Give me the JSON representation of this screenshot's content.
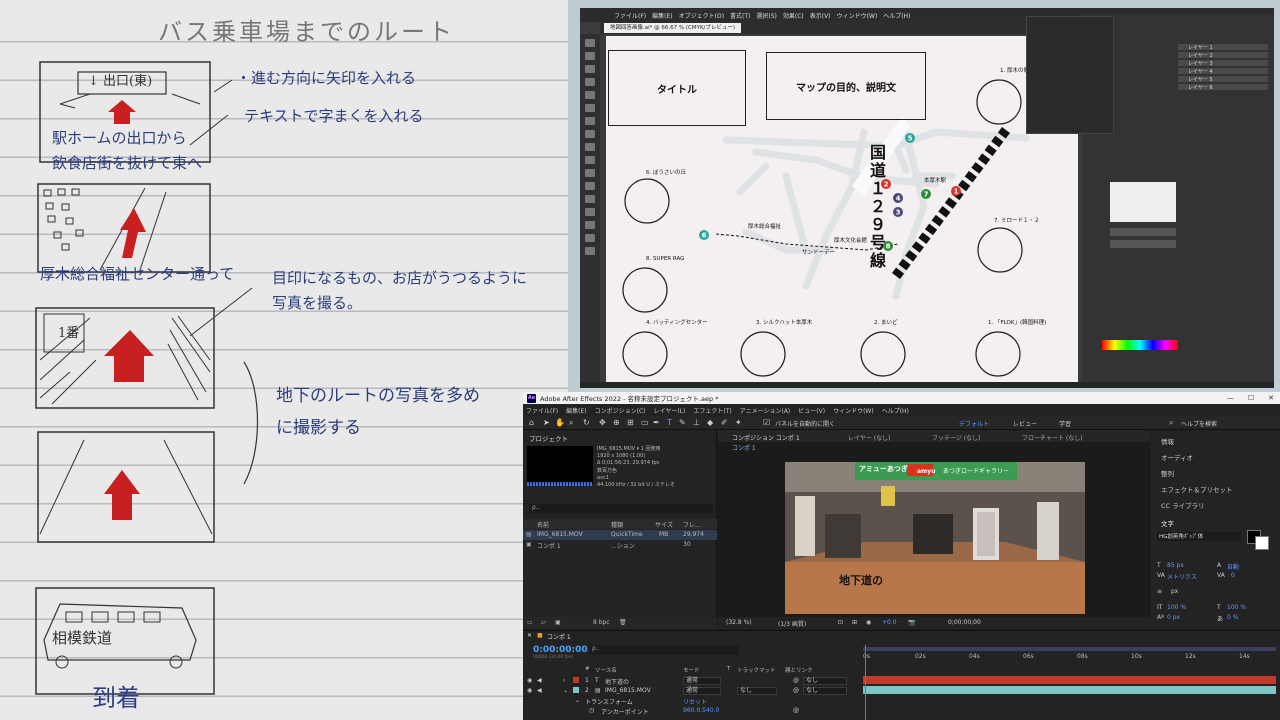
{
  "notebook": {
    "title": "バス乗車場までのルート",
    "frame1_sign": "↓ 出口(東)",
    "frame1_caption_lines": [
      "駅ホームの出口から",
      "飲食店街を抜けて東へ"
    ],
    "annotation_arrow": "・進む方向に矢印を入れる",
    "annotation_text": "テキストで字まくを入れる",
    "frame2_caption": "厚木総合福祉センター通って",
    "annotation_landmark_lines": [
      "目印になるもの、お店がうつるように",
      "写真を撮る。"
    ],
    "frame3_sign": "1番",
    "annotation_underground_lines": [
      "地下のルートの写真を多め",
      "に撮影する"
    ],
    "frame5_bus_label": "相模鉄道",
    "frame5_caption": "到着"
  },
  "illustrator": {
    "menu": [
      "ファイル(F)",
      "編集(E)",
      "オブジェクト(O)",
      "書式(T)",
      "選択(S)",
      "効果(C)",
      "表示(V)",
      "ウィンドウ(W)",
      "ヘルプ(H)"
    ],
    "tab": "地図回答画像.ai* @ 66.67 % (CMYK/プレビュー)",
    "box_title": "タイトル",
    "box_purpose": "マップの目的、説明文",
    "road_label": "国道１２９号線",
    "labels": {
      "atsugi": "1. 厚木の歌",
      "bousai": "6. ぼうさいの丘",
      "superrag": "8. SUPER RAG",
      "midori": "7. ミロード１・２",
      "batting": "4. バッティングセンター",
      "silkhat": "3. シルクハット本厚木",
      "maido": "2. まいど",
      "flok": "1. 「FLOK」(韓国料理)",
      "station": "本厚木駅",
      "kouen": "厚木文化会館",
      "fukushi": "厚木総合福祉",
      "sun": "サンドーデー"
    },
    "markers": [
      {
        "n": "1",
        "color": "#d8322a"
      },
      {
        "n": "2",
        "color": "#d8322a"
      },
      {
        "n": "3",
        "color": "#4a4a7a"
      },
      {
        "n": "4",
        "color": "#4a4a7a"
      },
      {
        "n": "5",
        "color": "#2aa69a"
      },
      {
        "n": "6",
        "color": "#2aa69a"
      },
      {
        "n": "7",
        "color": "#2e8a3a"
      },
      {
        "n": "8",
        "color": "#2e8a3a"
      }
    ],
    "panel_labels": [
      "レイヤー 1",
      "レイヤー 2",
      "レイヤー 3",
      "レイヤー 4",
      "レイヤー 5",
      "レイヤー 6"
    ]
  },
  "after_effects": {
    "title": "Adobe After Effects 2022 - 名称未設定プロジェクト.aep *",
    "logo": "Ae",
    "window_buttons": [
      "—",
      "☐",
      "✕"
    ],
    "menu": [
      "ファイル(F)",
      "編集(E)",
      "コンポジション(C)",
      "レイヤー(L)",
      "エフェクト(T)",
      "アニメーション(A)",
      "ビュー(V)",
      "ウィンドウ(W)",
      "ヘルプ(H)"
    ],
    "toolbar": {
      "snap_label": "パネルを自動的に開く",
      "workspace_default": "デフォルト",
      "workspace_review": "レビュー",
      "workspace_learn": "学習",
      "help_search": "ヘルプを検索"
    },
    "project": {
      "title": "プロジェクト",
      "file_name": "IMG_6815.MOV ▾ 1 回使用",
      "meta_lines": [
        "1920 x 1080 (1.00)",
        "Δ 0;01;56;23, 29.974 fps",
        "数百万色",
        "avc1",
        "44.100 kHz / 32 bit U / ステレオ"
      ],
      "search_placeholder": "ρ‥",
      "columns": {
        "name": "名前",
        "type": "種類",
        "size": "サイズ",
        "fps": "フレ..."
      },
      "rows": [
        {
          "name": "IMG_6815.MOV",
          "type": "QuickTime",
          "size": "MB",
          "fps": "29.974"
        },
        {
          "name": "コンポ 1",
          "type": "...ション",
          "size": "",
          "fps": "30"
        }
      ],
      "bpc": "8 bpc"
    },
    "composition": {
      "tab_comp": "コンポジション コンポ 1",
      "tab_layer": "レイヤー (なし)",
      "tab_footage": "フッテージ (なし)",
      "tab_flow": "フローチャート (なし)",
      "sub_tab": "コンポ 1",
      "sign_text": "アミューあつぎ",
      "sign_brand": "amyu",
      "sign_gallery": "あつぎロードギャラリー",
      "overlay_text": "地下道の",
      "zoom": "(32.8 %)",
      "resolution": "(1/3 画質)",
      "exposure": "+0.0",
      "time": "0;00;00;00"
    },
    "right_panel": {
      "items": [
        "情報",
        "オーディオ",
        "整列",
        "エフェクト＆プリセット",
        "CC ライブラリ",
        "文字"
      ],
      "font": "HG創英角ﾎﾟｯﾌﾟ体",
      "font_size": "85 px",
      "leading": "自動",
      "tracking_label": "メトリクス",
      "tracking_value": "0",
      "stroke_unit": "px",
      "v_scale": "100 %",
      "h_scale": "100 %",
      "baseline": "0 px",
      "tsume": "0 %"
    },
    "timeline": {
      "tab": "コンポ 1",
      "timecode": "0:00:00:00",
      "timecode_sub": "00000 (30.00 fps)",
      "search_placeholder": "ρ‥",
      "columns": {
        "num": "#",
        "source": "ソース名",
        "mode": "モード",
        "t": "T",
        "matte": "トラックマット",
        "parent": "親とリンク"
      },
      "ruler": [
        "0s",
        "02s",
        "04s",
        "06s",
        "08s",
        "10s",
        "12s",
        "14s"
      ],
      "layers": [
        {
          "num": "1",
          "name": "地下道の",
          "mode": "通常",
          "matte": "",
          "parent": "なし",
          "label_color": "#c0392b"
        },
        {
          "num": "2",
          "name": "IMG_6815.MOV",
          "mode": "通常",
          "matte": "なし",
          "parent": "なし",
          "label_color": "#7ec4c4"
        }
      ],
      "transform_label": "トランスフォーム",
      "reset_label": "リセット",
      "anchor_label": "アンカーポイント",
      "anchor_value": "960.0,540.0"
    }
  }
}
